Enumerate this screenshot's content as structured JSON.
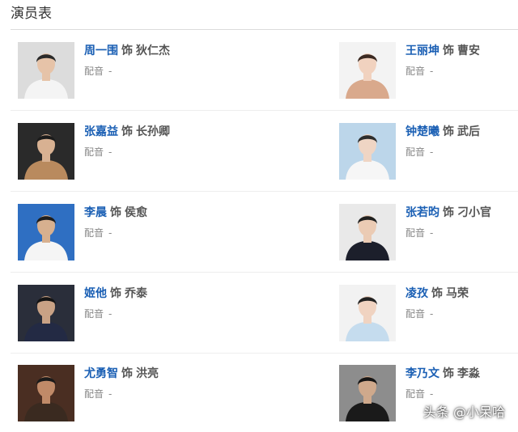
{
  "section_title": "演员表",
  "connector": "饰",
  "voice_label": "配音",
  "voice_value": "-",
  "watermark": "头条 @小呆哈",
  "cast": [
    {
      "actor": "周一围",
      "role": "狄仁杰",
      "photo": {
        "bg": "#dcdcdc",
        "shirt": "#f4f4f4",
        "skin": "#e6c3a8",
        "hair": "#2a2a2a"
      }
    },
    {
      "actor": "王丽坤",
      "role": "曹安",
      "photo": {
        "bg": "#f3f3f3",
        "shirt": "#d9a98c",
        "skin": "#f1d2bf",
        "hair": "#3b2a22"
      }
    },
    {
      "actor": "张嘉益",
      "role": "长孙卿",
      "photo": {
        "bg": "#2a2a2a",
        "shirt": "#b98a5e",
        "skin": "#d8b192",
        "hair": "#1b1b1b"
      }
    },
    {
      "actor": "钟楚曦",
      "role": "武后",
      "photo": {
        "bg": "#bcd6ea",
        "shirt": "#f6f6f6",
        "skin": "#efd5c4",
        "hair": "#2d2d2d"
      }
    },
    {
      "actor": "李晨",
      "role": "侯愈",
      "photo": {
        "bg": "#2f6fc2",
        "shirt": "#f5f5f5",
        "skin": "#d7b08f",
        "hair": "#1d1d1d"
      }
    },
    {
      "actor": "张若昀",
      "role": "刁小官",
      "photo": {
        "bg": "#e9e9e9",
        "shirt": "#1c1f2b",
        "skin": "#ebcbb4",
        "hair": "#1f1f1f"
      }
    },
    {
      "actor": "姬他",
      "role": "乔泰",
      "photo": {
        "bg": "#2a2e3a",
        "shirt": "#232a44",
        "skin": "#c9a285",
        "hair": "#141414"
      }
    },
    {
      "actor": "凌孜",
      "role": "马荣",
      "photo": {
        "bg": "#f2f2f2",
        "shirt": "#c5dcee",
        "skin": "#f0d3c1",
        "hair": "#222222"
      }
    },
    {
      "actor": "尤勇智",
      "role": "洪亮",
      "photo": {
        "bg": "#4a2e22",
        "shirt": "#3a2a20",
        "skin": "#c08a68",
        "hair": "#1a1a1a"
      }
    },
    {
      "actor": "李乃文",
      "role": "李淼",
      "photo": {
        "bg": "#8d8d8d",
        "shirt": "#1a1a1a",
        "skin": "#cfa98c",
        "hair": "#151515"
      }
    }
  ]
}
